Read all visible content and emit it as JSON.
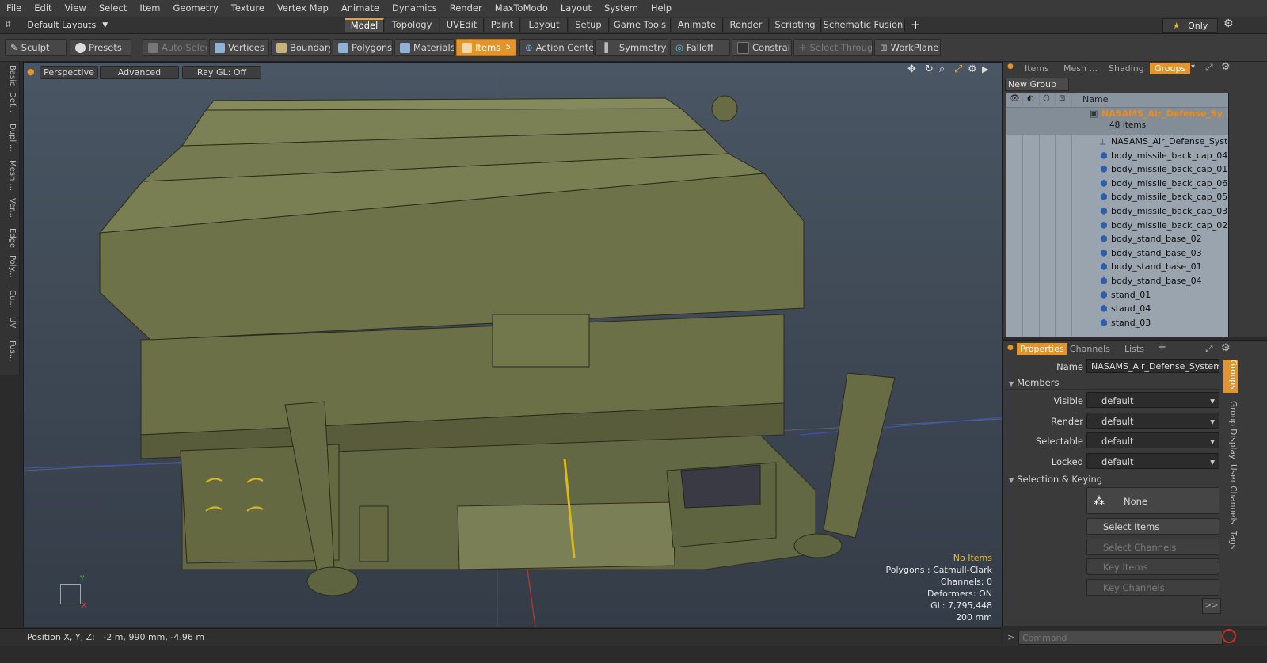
{
  "menu": [
    "File",
    "Edit",
    "View",
    "Select",
    "Item",
    "Geometry",
    "Texture",
    "Vertex Map",
    "Animate",
    "Dynamics",
    "Render",
    "MaxToModo",
    "Layout",
    "System",
    "Help"
  ],
  "layouts_label": "Default Layouts",
  "tabs": [
    "Model",
    "Topology",
    "UVEdit",
    "Paint",
    "Layout",
    "Setup",
    "Game Tools",
    "Animate",
    "Render",
    "Scripting",
    "Schematic Fusion"
  ],
  "tab_add": "+",
  "only_label": "Only",
  "toolbar": {
    "sculpt": "Sculpt",
    "presets": "Presets",
    "auto_select": "Auto Select",
    "vertices": "Vertices",
    "vertices_count": "1",
    "boundary": "Boundary",
    "polygons": "Polygons",
    "materials": "Materials",
    "items": "Items",
    "items_count": "5",
    "action_center": "Action Center",
    "symmetry": "Symmetry",
    "falloff": "Falloff",
    "constraints": "Constrai...",
    "select_through": "Select Through",
    "workplane": "WorkPlane"
  },
  "left_tabs": [
    "Basic",
    "Def...",
    "Dupli...",
    "Mesh ...",
    "Ver...",
    "Edge",
    "Poly...",
    "Cu...",
    "UV",
    "Fus..."
  ],
  "viewport": {
    "perspective": "Perspective",
    "advanced": "Advanced",
    "raygl": "Ray GL: Off",
    "axis_x": "X",
    "axis_y": "Y",
    "info": [
      "No Items",
      "Polygons : Catmull-Clark",
      "Channels: 0",
      "Deformers: ON",
      "GL: 7,795,448",
      "200 mm"
    ]
  },
  "status": "Position X, Y, Z:   -2 m, 990 mm, -4.96 m",
  "right_top": {
    "tabs": [
      "Items",
      "Mesh ...",
      "Shading",
      "Groups"
    ],
    "active_tab": "Groups",
    "new_group": "New Group",
    "col_name": "Name",
    "group_name": "NASAMS_Air_Defense_Sy ...",
    "group_count": "48 Items",
    "items": [
      "NASAMS_Air_Defense_Syst...",
      "body_missile_back_cap_04",
      "body_missile_back_cap_01",
      "body_missile_back_cap_06",
      "body_missile_back_cap_05",
      "body_missile_back_cap_03",
      "body_missile_back_cap_02",
      "body_stand_base_02",
      "body_stand_base_03",
      "body_stand_base_01",
      "body_stand_base_04",
      "stand_01",
      "stand_04",
      "stand_03"
    ]
  },
  "properties": {
    "tabs": [
      "Properties",
      "Channels",
      "Lists"
    ],
    "tab_add": "+",
    "name_label": "Name",
    "name_value": "NASAMS_Air_Defense_System_is",
    "members": "Members",
    "visible_label": "Visible",
    "render_label": "Render",
    "selectable_label": "Selectable",
    "locked_label": "Locked",
    "default": "default",
    "sel_keying": "Selection & Keying",
    "none": "None",
    "select_items": "Select Items",
    "select_channels": "Select Channels",
    "key_items": "Key Items",
    "key_channels": "Key Channels",
    "more": ">>",
    "side_tabs": [
      "Groups",
      "Group Display",
      "User Channels",
      "Tags"
    ]
  },
  "command_placeholder": "Command",
  "colors": {
    "accent": "#e2952c",
    "model": "#6b7047",
    "list_bg": "#9aa4ae"
  }
}
